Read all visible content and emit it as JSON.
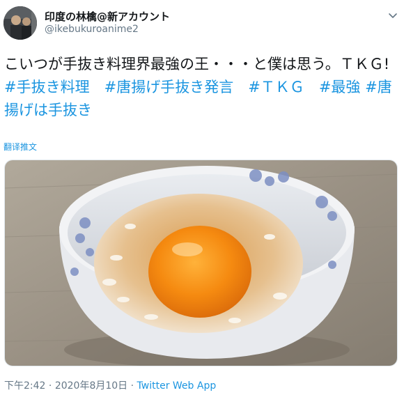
{
  "author": {
    "display_name": "印度の林檎@新アカウント",
    "handle": "@ikebukuroanime2"
  },
  "tweet": {
    "text": "こいつが手抜き料理界最強の王・・・と僕は思う。ＴＫＧ!",
    "hashtags": [
      "#手抜き料理",
      "#唐揚げ手抜き発言",
      "#ＴＫＧ",
      "#最強",
      "#唐揚げは手抜き"
    ],
    "translate_label": "翻译推文"
  },
  "meta": {
    "time": "下午2:42",
    "date": "2020年8月10日",
    "separator": "·",
    "source": "Twitter Web App"
  },
  "colors": {
    "link": "#1b95e0",
    "secondary_text": "#657786",
    "egg_yolk": "#f28a10",
    "bowl_pattern": "#7d8fc2",
    "table_wood": "#9a9184"
  },
  "icons": {
    "menu": "chevron-down-icon"
  }
}
